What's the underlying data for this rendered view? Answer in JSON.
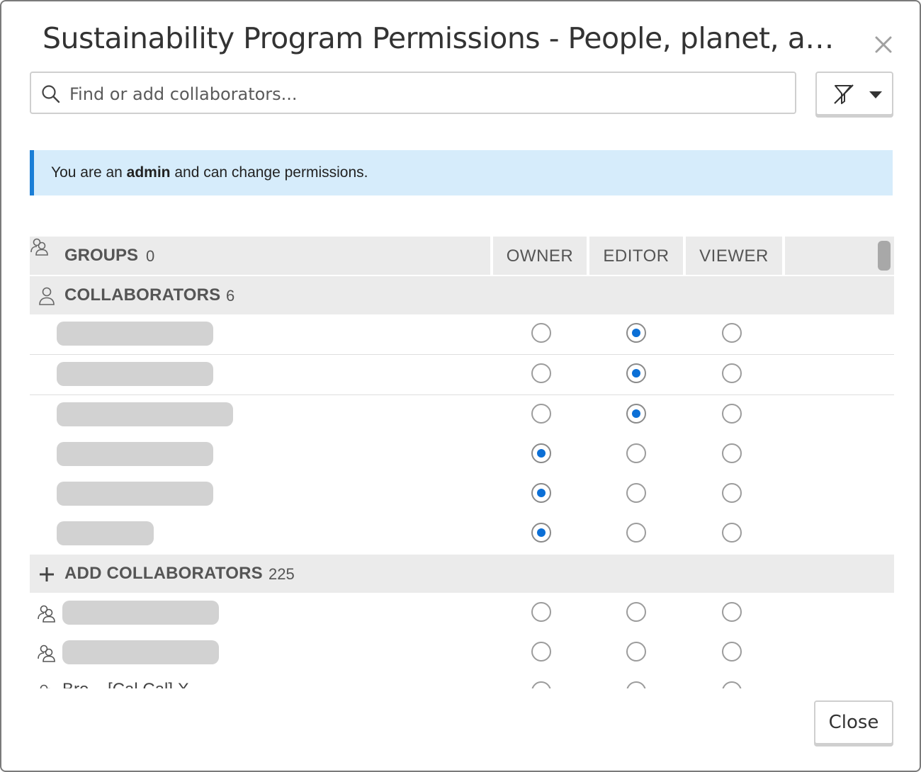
{
  "dialog": {
    "title": "Sustainability Program Permissions - People, planet, and po...",
    "close_button": "Close"
  },
  "search": {
    "placeholder": "Find or add collaborators..."
  },
  "banner": {
    "prefix": "You are an ",
    "role": "admin",
    "suffix": " and can change permissions."
  },
  "table": {
    "columns": {
      "groups": "GROUPS",
      "groups_count": "0",
      "owner": "OWNER",
      "editor": "EDITOR",
      "viewer": "VIEWER"
    },
    "collaborators": {
      "label": "COLLABORATORS",
      "count": "6",
      "rows": [
        {
          "selected": "editor"
        },
        {
          "selected": "editor"
        },
        {
          "selected": "editor"
        },
        {
          "selected": "owner"
        },
        {
          "selected": "owner"
        },
        {
          "selected": "owner"
        }
      ]
    },
    "add_collaborators": {
      "label": "ADD COLLABORATORS",
      "count": "225",
      "rows": [
        {
          "selected": "none",
          "partial_text": ""
        },
        {
          "selected": "none",
          "partial_text": ""
        },
        {
          "selected": "none",
          "partial_text": "Bre... [Cal Cal] X..."
        }
      ]
    }
  },
  "colors": {
    "accent": "#0b6fd6",
    "banner_bg": "#d6ecfb",
    "banner_border": "#1a7ed6"
  },
  "icons": [
    "close-icon",
    "search-icon",
    "filter-off-icon",
    "chevron-down-icon",
    "group-icon",
    "user-icon",
    "plus-icon"
  ]
}
